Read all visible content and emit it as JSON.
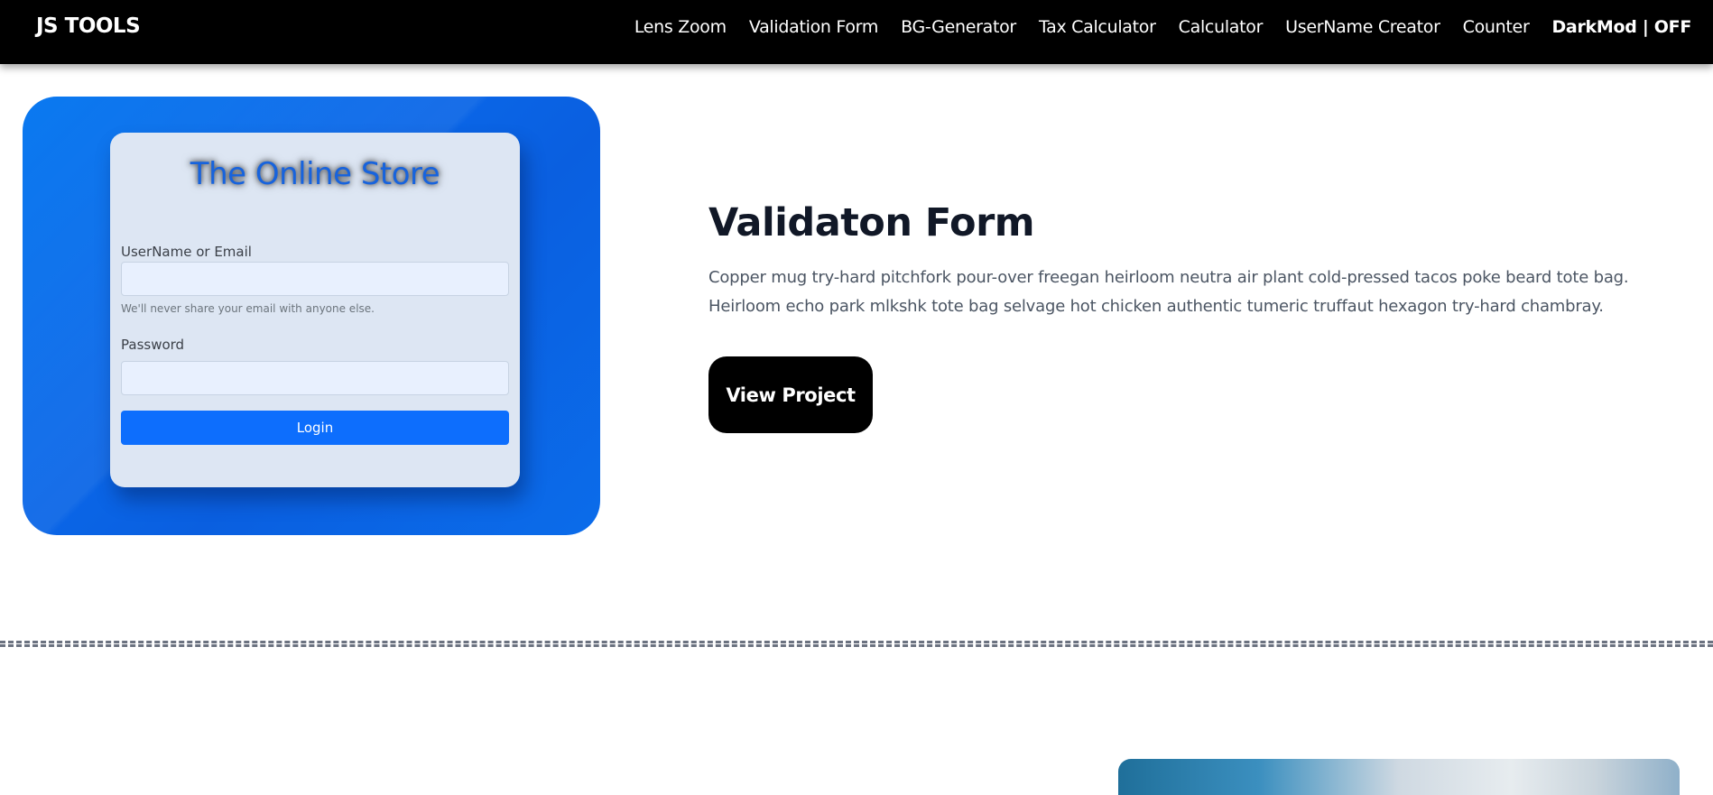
{
  "navbar": {
    "brand": "JS TOOLS",
    "links": [
      "Lens Zoom",
      "Validation Form",
      "BG-Generator",
      "Tax Calculator",
      "Calculator",
      "UserName Creator",
      "Counter"
    ],
    "darkmode_toggle": "DarkMod | OFF"
  },
  "preview": {
    "store_title": "The Online Store",
    "username_label": "UserName or Email",
    "email_help": "We'll never share your email with anyone else.",
    "password_label": "Password",
    "login_button": "Login",
    "accent_color": "#0d6efd"
  },
  "project": {
    "title": "Validaton Form",
    "description": "Copper mug try-hard pitchfork pour-over freegan heirloom neutra air plant cold-pressed tacos poke beard tote bag. Heirloom echo park mlkshk tote bag selvage hot chicken authentic tumeric truffaut hexagon try-hard chambray.",
    "view_button": "View Project"
  }
}
